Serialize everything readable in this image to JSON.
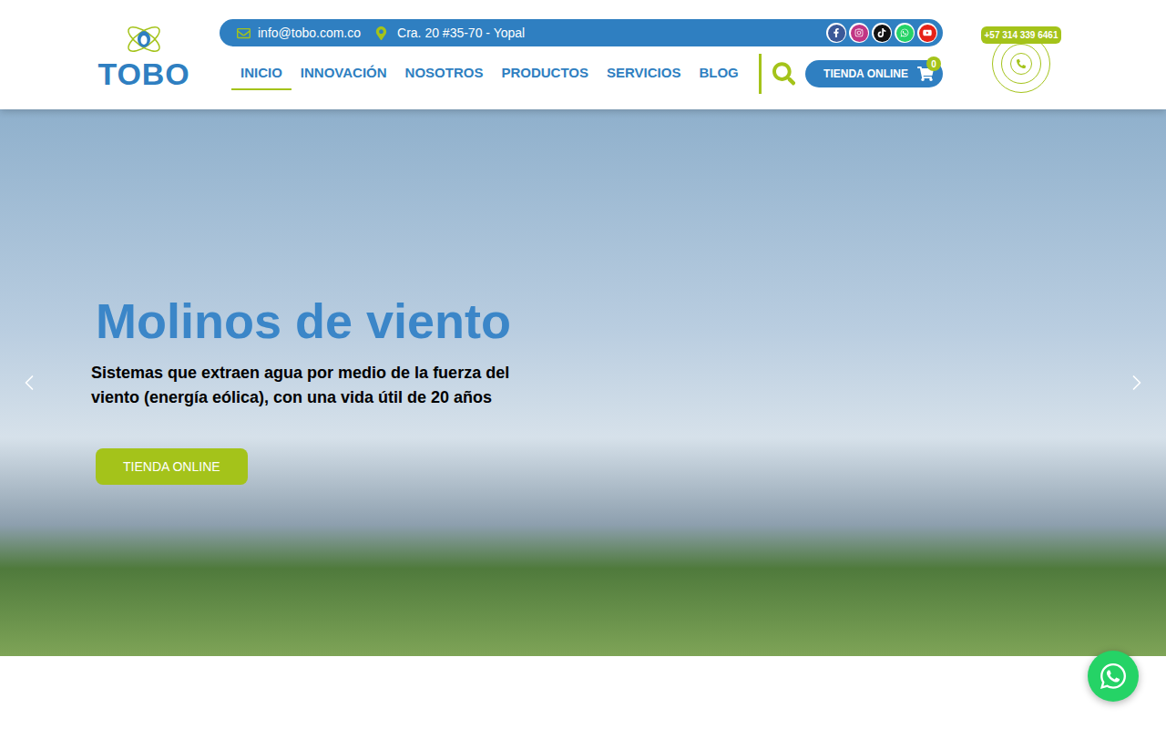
{
  "header": {
    "logo": "TOBO",
    "email": "info@tobo.com.co",
    "address": "Cra. 20 #35-70 - Yopal",
    "phone": "+57 314 339 6461"
  },
  "social": [
    {
      "kind": "facebook",
      "color": "#3b5998"
    },
    {
      "kind": "instagram",
      "color": "#c13584"
    },
    {
      "kind": "tiktok",
      "color": "#111111"
    },
    {
      "kind": "whatsapp",
      "color": "#25d366"
    },
    {
      "kind": "youtube",
      "color": "#e62117"
    }
  ],
  "nav": [
    {
      "label": "INICIO",
      "selected": true
    },
    {
      "label": "INNOVACIÓN",
      "selected": false
    },
    {
      "label": "NOSOTROS",
      "selected": false
    },
    {
      "label": "PRODUCTOS",
      "selected": false
    },
    {
      "label": "SERVICIOS",
      "selected": false
    },
    {
      "label": "BLOG",
      "selected": false
    }
  ],
  "cart": {
    "label": "TIENDA ONLINE",
    "count": "0"
  },
  "hero": {
    "title": "Molinos de viento",
    "subtitle": "Sistemas que extraen agua por medio de la fuerza del viento (energía eólica), con una vida útil de 20 años",
    "button": "TIENDA ONLINE"
  }
}
